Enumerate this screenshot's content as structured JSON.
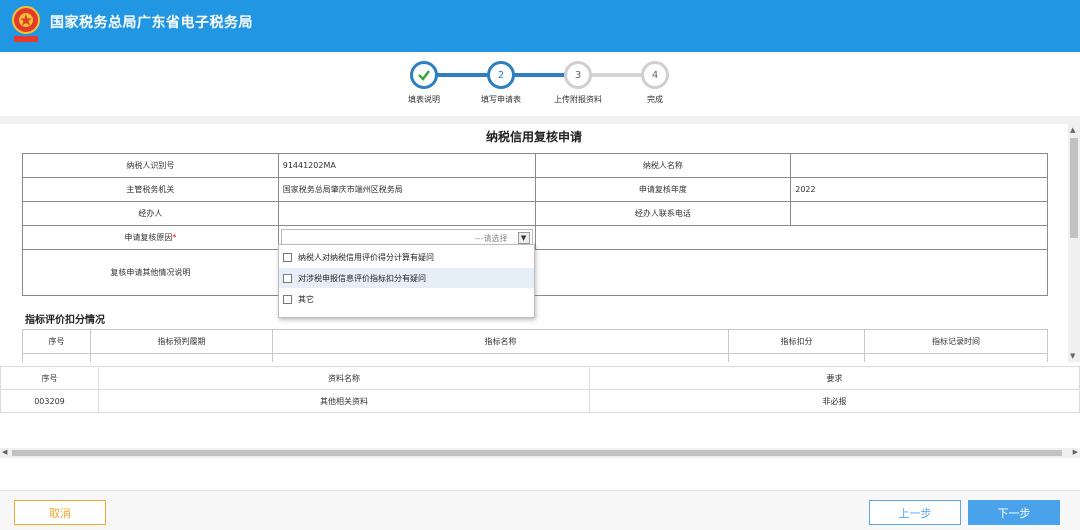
{
  "header": {
    "title": "国家税务总局广东省电子税务局",
    "bg_color": "#2196e3"
  },
  "stepper": {
    "steps": [
      {
        "num": "✓",
        "label": "填表说明",
        "state": "done"
      },
      {
        "num": "2",
        "label": "填写申请表",
        "state": "active"
      },
      {
        "num": "3",
        "label": "上传附报资料",
        "state": "pending"
      },
      {
        "num": "4",
        "label": "完成",
        "state": "pending"
      }
    ],
    "accent": "#2e7fbf"
  },
  "form": {
    "title": "纳税信用复核申请",
    "taxpayer_id_label": "纳税人识别号",
    "taxpayer_id_value": "91441202MA",
    "taxpayer_name_label": "纳税人名称",
    "taxpayer_name_value": "",
    "authority_label": "主管税务机关",
    "authority_value": "国家税务总局肇庆市端州区税务局",
    "year_label": "申请复核年度",
    "year_value": "2022",
    "handler_label": "经办人",
    "handler_value": "",
    "handler_phone_label": "经办人联系电话",
    "handler_phone_value": "",
    "reason_label": "申请复核原因",
    "reason_required": "*",
    "reason_placeholder": "---请选择",
    "other_label": "复核申请其他情况说明"
  },
  "dropdown": {
    "options": [
      {
        "label": "纳税人对纳税信用评价得分计算有疑问",
        "highlighted": false
      },
      {
        "label": "对涉税申报信息评价指标扣分有疑问",
        "highlighted": true
      },
      {
        "label": "其它",
        "highlighted": false
      }
    ]
  },
  "eval": {
    "title": "指标评价扣分情况",
    "columns": [
      "序号",
      "指标预判履期",
      "指标名称",
      "指标扣分",
      "指标记录时间"
    ]
  },
  "attachments": {
    "columns": [
      "序号",
      "资料名称",
      "要求"
    ],
    "rows": [
      {
        "id": "003209",
        "name": "其他相关资料",
        "requirement": "非必报"
      }
    ]
  },
  "footer": {
    "cancel_label": "取消",
    "prev_label": "上一步",
    "next_label": "下一步"
  }
}
